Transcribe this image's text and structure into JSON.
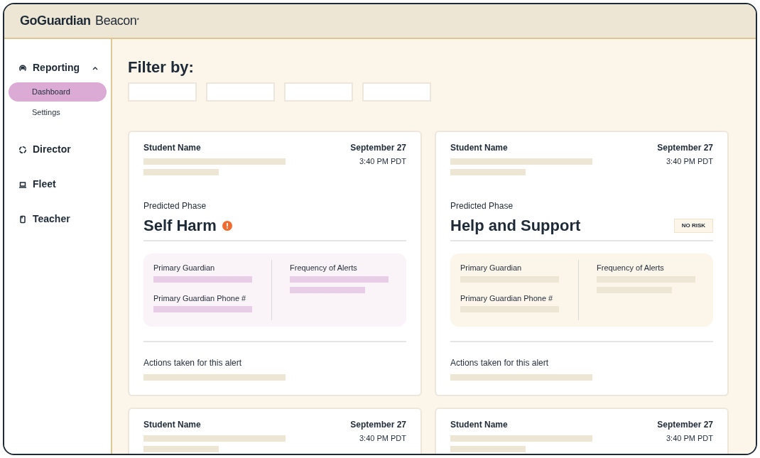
{
  "header": {
    "brand": "GoGuardian",
    "product": "Beacon",
    "mark": "*"
  },
  "sidebar": {
    "items": [
      {
        "label": "Reporting",
        "expanded": true,
        "children": [
          {
            "label": "Dashboard",
            "selected": true
          },
          {
            "label": "Settings",
            "selected": false
          }
        ]
      },
      {
        "label": "Director"
      },
      {
        "label": "Fleet"
      },
      {
        "label": "Teacher"
      }
    ]
  },
  "filter": {
    "title": "Filter by:",
    "fields": [
      {
        "kind": "dropdown"
      },
      {
        "kind": "dropdown"
      },
      {
        "kind": "dropdown"
      },
      {
        "kind": "dropdown"
      }
    ]
  },
  "cards": [
    {
      "kind": "alert",
      "student_label": "Student Name",
      "date": "September 27",
      "time": "3:40 PM PDT",
      "phase_label": "Predicted Phase",
      "phase": "Self Harm",
      "guardian_label": "Primary Guardian",
      "phone_label": "Primary Guardian Phone #",
      "frequency_label": "Frequency of Alerts",
      "actions_label": "Actions taken for this alert"
    },
    {
      "kind": "no_risk",
      "badge": "NO RISK",
      "student_label": "Student Name",
      "date": "September 27",
      "time": "3:40 PM PDT",
      "phase_label": "Predicted Phase",
      "phase": "Help and Support",
      "guardian_label": "Primary Guardian",
      "phone_label": "Primary Guardian Phone #",
      "frequency_label": "Frequency of Alerts",
      "actions_label": "Actions taken for this alert"
    },
    {
      "kind": "alert",
      "student_label": "Student Name",
      "date": "September 27",
      "time": "3:40 PM PDT"
    },
    {
      "kind": "no_risk",
      "student_label": "Student Name",
      "date": "September 27",
      "time": "3:40 PM PDT"
    }
  ]
}
